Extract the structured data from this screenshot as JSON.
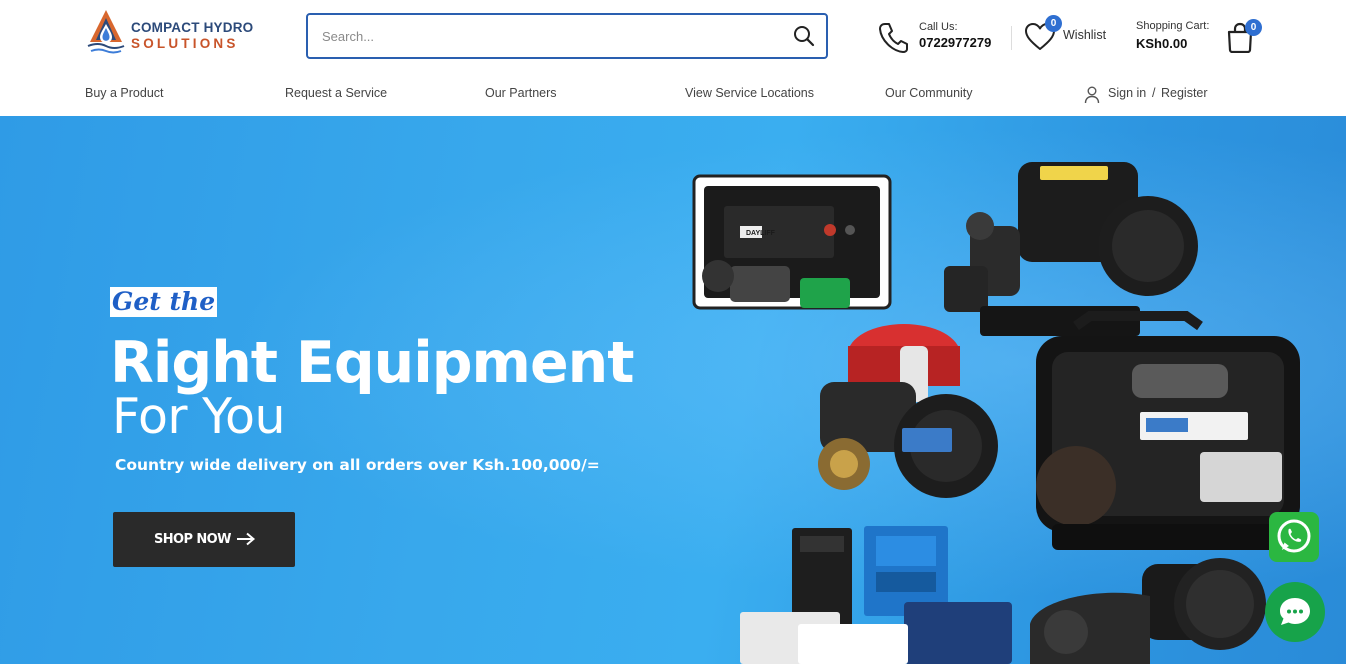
{
  "brand": {
    "line1": "COMPACT HYDRO",
    "line2": "SOLUTIONS"
  },
  "search": {
    "placeholder": "Search..."
  },
  "contact": {
    "label": "Call Us:",
    "number": "0722977279"
  },
  "wishlist": {
    "label": "Wishlist",
    "count": "0"
  },
  "cart": {
    "label": "Shopping Cart:",
    "amount": "KSh0.00",
    "count": "0"
  },
  "nav": {
    "items": [
      {
        "label": "Buy a Product"
      },
      {
        "label": "Request a Service"
      },
      {
        "label": "Our Partners"
      },
      {
        "label": "View Service Locations"
      },
      {
        "label": "Our Community"
      }
    ],
    "sign_in": "Sign in",
    "separator": "/",
    "register": "Register"
  },
  "hero": {
    "kicker": "Get the",
    "title": "Right Equipment",
    "title_sub": "For You",
    "subtitle": "Country wide delivery on all orders over Ksh.100,000/=",
    "cta_label": "SHOP NOW",
    "product_brand": "DAYLIFF"
  },
  "colors": {
    "accent": "#2f6fd1",
    "search_border": "#2a5fb0",
    "hero_bg": "#38a8ec",
    "cta_bg": "#2a2a2a",
    "whatsapp": "#2bb741",
    "chat": "#17a34a"
  },
  "icons": [
    "brand-logo-icon",
    "search-icon",
    "phone-icon",
    "heart-icon",
    "shopping-bag-icon",
    "user-icon",
    "arrow-right-icon",
    "whatsapp-icon",
    "chat-bubble-icon"
  ]
}
